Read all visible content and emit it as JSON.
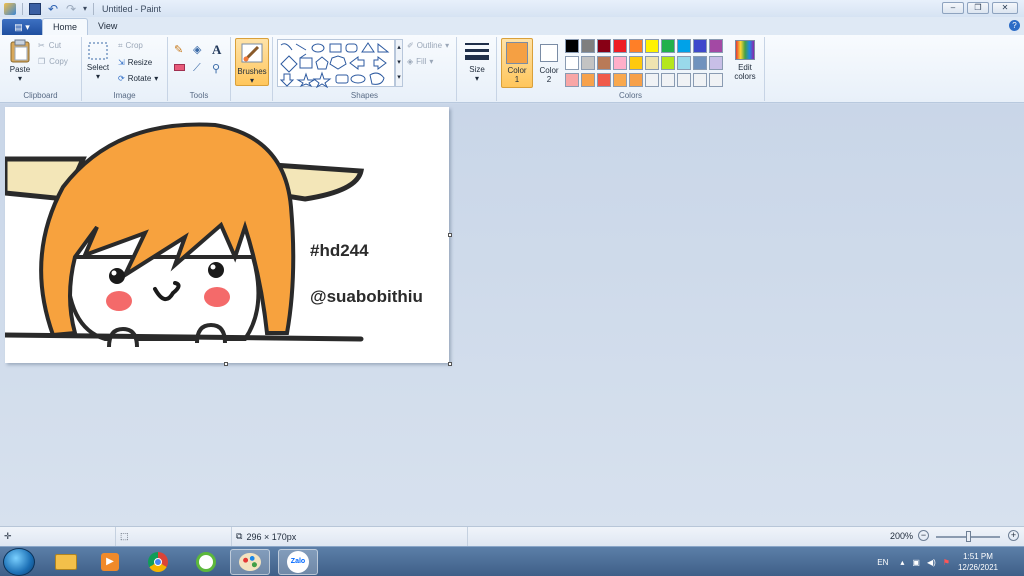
{
  "window": {
    "title": "Untitled - Paint",
    "controls": {
      "minimize": "‒",
      "maximize": "❐",
      "close": "✕"
    }
  },
  "tabs": [
    {
      "label": "Home",
      "active": true
    },
    {
      "label": "View",
      "active": false
    }
  ],
  "ribbon": {
    "clipboard": {
      "label": "Clipboard",
      "paste": "Paste",
      "cut": "Cut",
      "copy": "Copy"
    },
    "image": {
      "label": "Image",
      "select": "Select",
      "crop": "Crop",
      "resize": "Resize",
      "rotate": "Rotate"
    },
    "tools": {
      "label": "Tools"
    },
    "brushes": {
      "label": "Brushes"
    },
    "shapes": {
      "label": "Shapes",
      "outline": "Outline",
      "fill": "Fill"
    },
    "size": {
      "label": "Size"
    },
    "colors": {
      "label": "Colors",
      "color1": {
        "label": "Color",
        "index": "1",
        "value": "#f5a043"
      },
      "color2": {
        "label": "Color",
        "index": "2",
        "value": "#ffffff"
      },
      "edit": "Edit colors",
      "palette_row1": [
        "#000000",
        "#7f7f7f",
        "#880015",
        "#ed1c24",
        "#ff7f27",
        "#fff200",
        "#22b14c",
        "#00a2e8",
        "#3f48cc",
        "#a349a4"
      ],
      "palette_row2": [
        "#ffffff",
        "#c3c3c3",
        "#b97a57",
        "#ffaec9",
        "#ffc90e",
        "#efe4b0",
        "#b5e61d",
        "#99d9ea",
        "#7092be",
        "#c8bfe7"
      ],
      "palette_row3": [
        "#f8a6a6",
        "#f7a24c",
        "#f05a4a",
        "#f8a84e",
        "#f6a04a",
        "#f0f2f5",
        "#f0f2f5",
        "#f0f2f5",
        "#f0f2f5",
        "#f0f2f5"
      ]
    }
  },
  "canvas": {
    "text_tag": "#hd244",
    "text_handle": "@suabobithiu",
    "hair_color": "#f7a23e",
    "ear_color": "#f3e6b8",
    "cheek_color": "#f46a6a"
  },
  "statusbar": {
    "dimensions": "296 × 170px",
    "zoom": "200%",
    "zoom_level": 0.5
  },
  "taskbar": {
    "language": "EN",
    "time": "1:51 PM",
    "date": "12/26/2021",
    "zalo_label": "Zalo"
  }
}
